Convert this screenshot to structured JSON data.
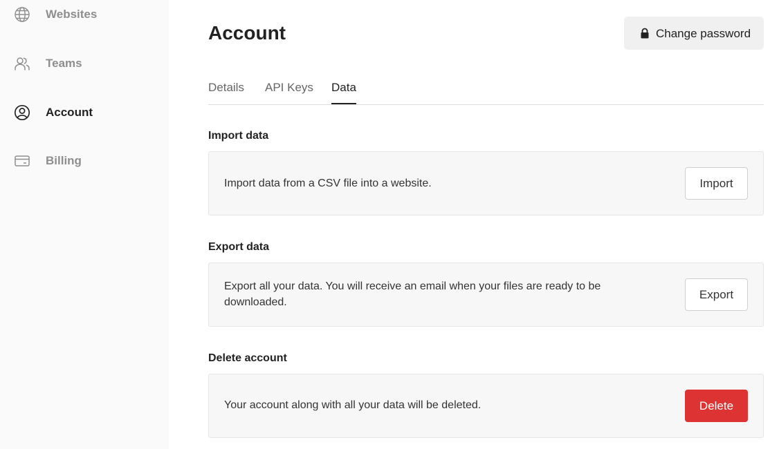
{
  "sidebar": {
    "items": [
      {
        "label": "Websites",
        "icon": "globe-icon",
        "active": false
      },
      {
        "label": "Teams",
        "icon": "users-icon",
        "active": false
      },
      {
        "label": "Account",
        "icon": "user-circle-icon",
        "active": true
      },
      {
        "label": "Billing",
        "icon": "credit-card-icon",
        "active": false
      }
    ]
  },
  "header": {
    "title": "Account",
    "change_password_label": "Change password",
    "change_password_icon": "lock-icon"
  },
  "tabs": [
    {
      "label": "Details",
      "active": false
    },
    {
      "label": "API Keys",
      "active": false
    },
    {
      "label": "Data",
      "active": true
    }
  ],
  "sections": {
    "import": {
      "title": "Import data",
      "description": "Import data from a CSV file into a website.",
      "button_label": "Import"
    },
    "export": {
      "title": "Export data",
      "description": "Export all your data. You will receive an email when your files are ready to be downloaded.",
      "button_label": "Export"
    },
    "delete": {
      "title": "Delete account",
      "description": "Your account along with all your data will be deleted.",
      "button_label": "Delete"
    }
  },
  "colors": {
    "sidebar_bg": "#fafafa",
    "danger": "#dd3333",
    "text_primary": "#222222",
    "text_muted": "#8e8e8e"
  }
}
